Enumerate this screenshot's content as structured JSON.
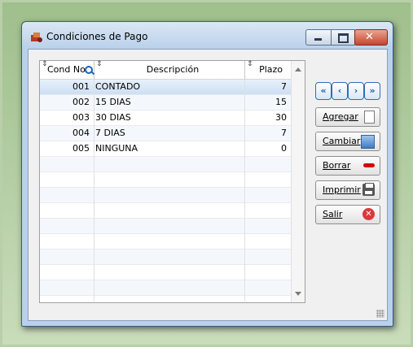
{
  "window": {
    "title": "Condiciones de Pago"
  },
  "grid": {
    "columns": {
      "code": "Cond No.",
      "desc": "Descripción",
      "plazo": "Plazo"
    },
    "rows": [
      {
        "code": "001",
        "desc": "CONTADO",
        "plazo": "7"
      },
      {
        "code": "002",
        "desc": "15 DIAS",
        "plazo": "15"
      },
      {
        "code": "003",
        "desc": "30 DIAS",
        "plazo": "30"
      },
      {
        "code": "004",
        "desc": "7 DIAS",
        "plazo": "7"
      },
      {
        "code": "005",
        "desc": "NINGUNA",
        "plazo": "0"
      }
    ],
    "selected_row": 0
  },
  "nav": {
    "first": "«",
    "prev": "‹",
    "next": "›",
    "last": "»"
  },
  "actions": {
    "agregar": "Agregar",
    "cambiar": "Cambiar",
    "borrar": "Borrar",
    "imprimir": "Imprimir",
    "salir": "Salir"
  }
}
